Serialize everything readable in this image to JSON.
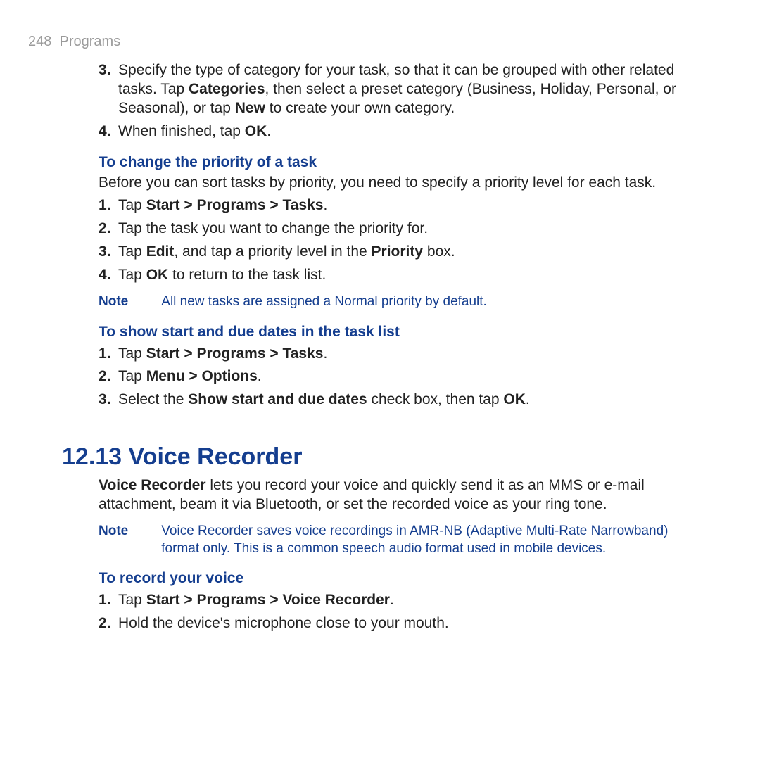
{
  "header": {
    "page_number": "248",
    "chapter": "Programs"
  },
  "top_list": {
    "item3": {
      "num": "3.",
      "pre": "Specify the type of category for your task, so that it can be grouped with other related tasks. Tap ",
      "b1": "Categories",
      "mid": ", then select a preset category (Business, Holiday, Personal, or Seasonal), or tap ",
      "b2": "New",
      "post": " to create your own category."
    },
    "item4": {
      "num": "4.",
      "pre": "When finished, tap ",
      "b1": "OK",
      "post": "."
    }
  },
  "priority": {
    "heading": "To change the priority of a task",
    "intro": "Before you can sort tasks by priority, you need to specify a priority level for each task.",
    "i1": {
      "num": "1.",
      "pre": "Tap ",
      "b1": "Start > Programs > Tasks",
      "post": "."
    },
    "i2": {
      "num": "2.",
      "text": "Tap the task you want to change the priority for."
    },
    "i3": {
      "num": "3.",
      "pre": "Tap ",
      "b1": "Edit",
      "mid": ", and tap a priority level in the ",
      "b2": "Priority",
      "post": " box."
    },
    "i4": {
      "num": "4.",
      "pre": "Tap ",
      "b1": "OK",
      "post": " to return to the task list."
    },
    "note": {
      "label": "Note",
      "text": "All new tasks are assigned a Normal priority by default."
    }
  },
  "dates": {
    "heading": "To show start and due dates in the task list",
    "i1": {
      "num": "1.",
      "pre": "Tap ",
      "b1": "Start > Programs > Tasks",
      "post": "."
    },
    "i2": {
      "num": "2.",
      "pre": "Tap ",
      "b1": "Menu > Options",
      "post": "."
    },
    "i3": {
      "num": "3.",
      "pre": "Select the ",
      "b1": "Show start and due dates",
      "mid": " check box, then tap ",
      "b2": "OK",
      "post": "."
    }
  },
  "voice": {
    "section_title": "12.13  Voice Recorder",
    "intro_b": "Voice Recorder",
    "intro_rest": " lets you record your voice and quickly send it as an MMS or e-mail attachment, beam it via Bluetooth, or set the recorded voice as your ring tone.",
    "note": {
      "label": "Note",
      "text": "Voice Recorder saves voice recordings in AMR-NB (Adaptive Multi-Rate Narrowband) format only. This is a common speech audio format used in mobile devices."
    },
    "heading": "To record your voice",
    "i1": {
      "num": "1.",
      "pre": "Tap ",
      "b1": "Start > Programs > Voice Recorder",
      "post": "."
    },
    "i2": {
      "num": "2.",
      "text": "Hold the device's microphone close to your mouth."
    }
  }
}
